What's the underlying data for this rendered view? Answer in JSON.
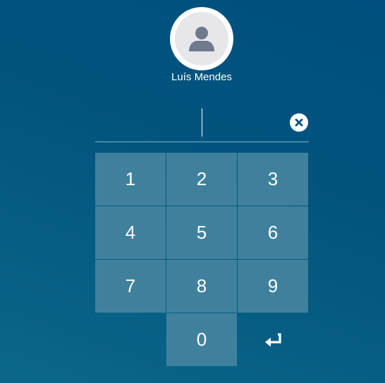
{
  "user": {
    "name": "Luís Mendes",
    "avatar_icon": "user-silhouette-icon"
  },
  "pin": {
    "value": "",
    "clear_icon": "close-circle-icon"
  },
  "keypad": {
    "keys": [
      "1",
      "2",
      "3",
      "4",
      "5",
      "6",
      "7",
      "8",
      "9",
      "0"
    ],
    "enter_icon": "enter-return-icon"
  },
  "colors": {
    "background_top": "#004f7e",
    "background_bottom": "#0b6789",
    "key_background": "#3f819c",
    "avatar_background": "#e7e7ea",
    "avatar_icon": "#6f7a8c"
  }
}
